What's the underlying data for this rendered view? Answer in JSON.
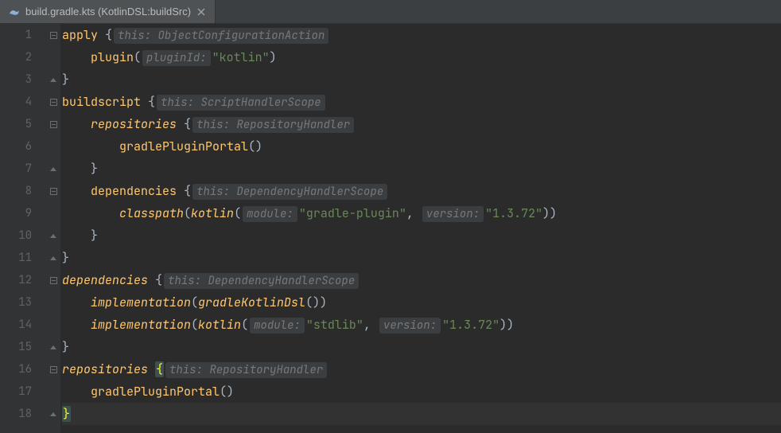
{
  "tab": {
    "title": "build.gradle.kts (KotlinDSL:buildSrc)"
  },
  "gutter": {
    "start": 1,
    "end": 18
  },
  "code": {
    "lines": [
      {
        "indent": 0,
        "segs": [
          {
            "t": "fn",
            "v": "apply"
          },
          {
            "t": "def",
            "v": " "
          },
          {
            "t": "punct",
            "v": "{"
          },
          {
            "t": "hint",
            "v": "this: ObjectConfigurationAction"
          }
        ]
      },
      {
        "indent": 1,
        "segs": [
          {
            "t": "fn",
            "v": "plugin"
          },
          {
            "t": "punct",
            "v": "("
          },
          {
            "t": "hint",
            "v": "pluginId:"
          },
          {
            "t": "str",
            "v": "\"kotlin\""
          },
          {
            "t": "punct",
            "v": ")"
          }
        ]
      },
      {
        "indent": 0,
        "segs": [
          {
            "t": "punct",
            "v": "}"
          }
        ]
      },
      {
        "indent": 0,
        "segs": [
          {
            "t": "fn",
            "v": "buildscript"
          },
          {
            "t": "def",
            "v": " "
          },
          {
            "t": "punct",
            "v": "{"
          },
          {
            "t": "hint",
            "v": "this: ScriptHandlerScope"
          }
        ]
      },
      {
        "indent": 1,
        "segs": [
          {
            "t": "fn-it",
            "v": "repositories"
          },
          {
            "t": "def",
            "v": " "
          },
          {
            "t": "punct",
            "v": "{"
          },
          {
            "t": "hint",
            "v": "this: RepositoryHandler"
          }
        ]
      },
      {
        "indent": 2,
        "segs": [
          {
            "t": "fn",
            "v": "gradlePluginPortal"
          },
          {
            "t": "punct",
            "v": "()"
          }
        ]
      },
      {
        "indent": 1,
        "segs": [
          {
            "t": "punct",
            "v": "}"
          }
        ]
      },
      {
        "indent": 1,
        "segs": [
          {
            "t": "fn",
            "v": "dependencies"
          },
          {
            "t": "def",
            "v": " "
          },
          {
            "t": "punct",
            "v": "{"
          },
          {
            "t": "hint",
            "v": "this: DependencyHandlerScope"
          }
        ]
      },
      {
        "indent": 2,
        "segs": [
          {
            "t": "fn-it",
            "v": "classpath"
          },
          {
            "t": "punct",
            "v": "("
          },
          {
            "t": "fn-it",
            "v": "kotlin"
          },
          {
            "t": "punct",
            "v": "("
          },
          {
            "t": "hint",
            "v": "module:"
          },
          {
            "t": "str",
            "v": "\"gradle-plugin\""
          },
          {
            "t": "punct",
            "v": ", "
          },
          {
            "t": "hint",
            "v": "version:"
          },
          {
            "t": "str",
            "v": "\"1.3.72\""
          },
          {
            "t": "punct",
            "v": "))"
          }
        ]
      },
      {
        "indent": 1,
        "segs": [
          {
            "t": "punct",
            "v": "}"
          }
        ]
      },
      {
        "indent": 0,
        "segs": [
          {
            "t": "punct",
            "v": "}"
          }
        ]
      },
      {
        "indent": 0,
        "segs": [
          {
            "t": "fn-it",
            "v": "dependencies"
          },
          {
            "t": "def",
            "v": " "
          },
          {
            "t": "punct",
            "v": "{"
          },
          {
            "t": "hint",
            "v": "this: DependencyHandlerScope"
          }
        ]
      },
      {
        "indent": 1,
        "segs": [
          {
            "t": "fn-it",
            "v": "implementation"
          },
          {
            "t": "punct",
            "v": "("
          },
          {
            "t": "fn-it",
            "v": "gradleKotlinDsl"
          },
          {
            "t": "punct",
            "v": "())"
          }
        ]
      },
      {
        "indent": 1,
        "segs": [
          {
            "t": "fn-it",
            "v": "implementation"
          },
          {
            "t": "punct",
            "v": "("
          },
          {
            "t": "fn-it",
            "v": "kotlin"
          },
          {
            "t": "punct",
            "v": "("
          },
          {
            "t": "hint",
            "v": "module:"
          },
          {
            "t": "str",
            "v": "\"stdlib\""
          },
          {
            "t": "punct",
            "v": ", "
          },
          {
            "t": "hint",
            "v": "version:"
          },
          {
            "t": "str",
            "v": "\"1.3.72\""
          },
          {
            "t": "punct",
            "v": "))"
          }
        ]
      },
      {
        "indent": 0,
        "segs": [
          {
            "t": "punct",
            "v": "}"
          }
        ]
      },
      {
        "indent": 0,
        "segs": [
          {
            "t": "fn-it",
            "v": "repositories"
          },
          {
            "t": "def",
            "v": " "
          },
          {
            "t": "hl-brace",
            "v": "{"
          },
          {
            "t": "hint",
            "v": "this: RepositoryHandler"
          }
        ]
      },
      {
        "indent": 1,
        "segs": [
          {
            "t": "fn",
            "v": "gradlePluginPortal"
          },
          {
            "t": "punct",
            "v": "()"
          }
        ]
      },
      {
        "indent": 0,
        "caret": true,
        "segs": [
          {
            "t": "hl-brace2",
            "v": "}"
          }
        ]
      }
    ]
  },
  "fold": {
    "marks": {
      "1": "minus",
      "3": "up",
      "4": "minus",
      "5": "minus",
      "7": "up",
      "8": "minus",
      "10": "up",
      "11": "up",
      "12": "minus",
      "15": "up",
      "16": "minus",
      "18": "up"
    }
  }
}
